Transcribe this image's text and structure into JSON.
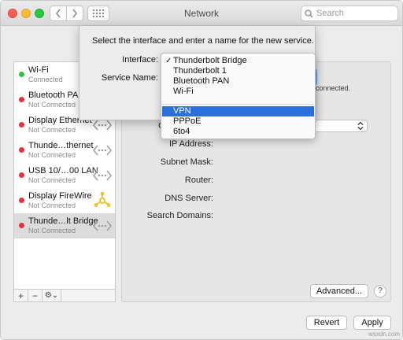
{
  "window": {
    "title": "Network"
  },
  "toolbar": {
    "search_placeholder": "Search"
  },
  "sidebar": {
    "services": [
      {
        "name": "Wi-Fi",
        "status": "Connected",
        "dot": "green",
        "icon": "wifi-icon"
      },
      {
        "name": "Bluetooth PAN",
        "status": "Not Connected",
        "dot": "red",
        "icon": "bluetooth-icon"
      },
      {
        "name": "Display Ethernet",
        "status": "Not Connected",
        "dot": "red",
        "icon": "ethernet-icon"
      },
      {
        "name": "Thunde…thernet",
        "status": "Not Connected",
        "dot": "red",
        "icon": "ethernet-icon"
      },
      {
        "name": "USB 10/…00 LAN",
        "status": "Not Connected",
        "dot": "red",
        "icon": "ethernet-icon"
      },
      {
        "name": "Display FireWire",
        "status": "Not Connected",
        "dot": "red",
        "icon": "firewire-icon"
      },
      {
        "name": "Thunde…lt Bridge",
        "status": "Not Connected",
        "dot": "red",
        "icon": "ethernet-icon"
      }
    ],
    "tools": {
      "add": "+",
      "remove": "−",
      "gear": "⚙︎⌄"
    }
  },
  "detail": {
    "status_fragment": "connected.",
    "config_label": "C",
    "fields": [
      "IP Address:",
      "Subnet Mask:",
      "Router:",
      "DNS Server:",
      "Search Domains:"
    ],
    "advanced_label": "Advanced...",
    "help_label": "?"
  },
  "footer": {
    "revert_label": "Revert",
    "apply_label": "Apply"
  },
  "sheet": {
    "instruction": "Select the interface and enter a name for the new service.",
    "interface_label": "Interface:",
    "service_name_label": "Service Name:"
  },
  "menu": {
    "items": [
      {
        "label": "Thunderbolt Bridge",
        "checked": "✓"
      },
      {
        "label": "Thunderbolt 1"
      },
      {
        "label": "Bluetooth PAN"
      },
      {
        "label": "Wi-Fi"
      },
      {
        "label": "VPN",
        "highlighted": true
      },
      {
        "label": "PPPoE"
      },
      {
        "label": "6to4"
      }
    ]
  },
  "watermark": "wsxdn.com",
  "colors": {
    "accent": "#2a6fdb",
    "connected": "#2fc341",
    "disconnected": "#e5313a"
  }
}
